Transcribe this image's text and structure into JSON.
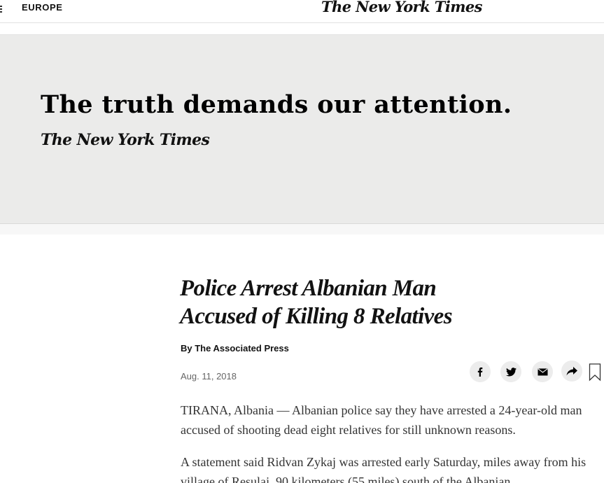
{
  "header": {
    "section": "EUROPE",
    "masthead": "The New York Times"
  },
  "ad": {
    "headline": "The truth demands our attention.",
    "logo": "The New York Times",
    "background": "#ebebea"
  },
  "article": {
    "headline_lines": [
      "Police Arrest Albanian Man",
      "Accused of Killing 8 Relatives"
    ],
    "byline": "By The Associated Press",
    "date": "Aug. 11, 2018",
    "paragraphs": [
      "TIRANA, Albania — Albanian police say they have arrested a 24-year-old man accused of shooting dead eight relatives for still unknown reasons.",
      "A statement said Ridvan Zykaj was arrested early Saturday, miles away from his village of Resulaj, 90 kilometers (55 miles) south of the Albanian"
    ]
  },
  "share": {
    "icons": [
      "facebook-icon",
      "twitter-icon",
      "email-icon",
      "share-icon",
      "bookmark-icon"
    ]
  }
}
